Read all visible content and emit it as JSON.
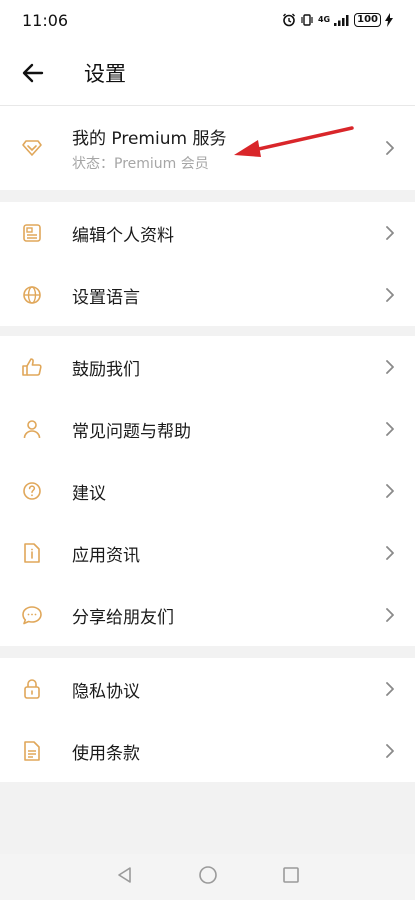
{
  "status_bar": {
    "time": "11:06",
    "network": "4G",
    "battery": "100"
  },
  "header": {
    "title": "设置"
  },
  "premium": {
    "title": "我的 Premium 服务",
    "subtitle": "状态：Premium 会员"
  },
  "profile_section": [
    {
      "label": "编辑个人资料",
      "icon": "profile-card-icon"
    },
    {
      "label": "设置语言",
      "icon": "globe-icon"
    }
  ],
  "support_section": [
    {
      "label": "鼓励我们",
      "icon": "thumbs-up-icon"
    },
    {
      "label": "常见问题与帮助",
      "icon": "person-icon"
    },
    {
      "label": "建议",
      "icon": "question-circle-icon"
    },
    {
      "label": "应用资讯",
      "icon": "info-document-icon"
    },
    {
      "label": "分享给朋友们",
      "icon": "chat-bubble-icon"
    }
  ],
  "legal_section": [
    {
      "label": "隐私协议",
      "icon": "lock-icon"
    },
    {
      "label": "使用条款",
      "icon": "document-icon"
    }
  ],
  "colors": {
    "accent": "#e0a75a",
    "annotation_arrow": "#d9262a",
    "chevron": "#8a8a8a"
  }
}
